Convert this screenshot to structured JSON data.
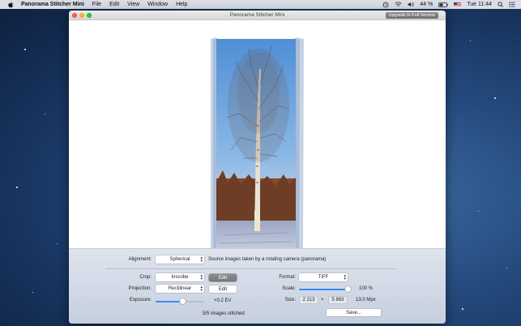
{
  "menubar": {
    "app_name": "Panorama Stitcher Mini",
    "menus": [
      "File",
      "Edit",
      "View",
      "Window",
      "Help"
    ],
    "battery": "44 %",
    "clock": "Tue 11:44",
    "icons": [
      "time-machine-icon",
      "wifi-icon",
      "volume-icon",
      "battery-icon",
      "flag-icon",
      "spotlight-icon",
      "notification-icon"
    ]
  },
  "window": {
    "title": "Panorama Stitcher Mini",
    "upgrade_label": "Upgrade to Full Version"
  },
  "controls": {
    "alignment_label": "Alignment:",
    "alignment_value": "Spherical",
    "alignment_hint": "Source images taken by a rotating camera (panorama)",
    "crop_label": "Crop:",
    "crop_value": "Inscribe",
    "crop_edit": "Edit",
    "projection_label": "Projection:",
    "projection_value": "Rectilinear",
    "projection_edit": "Edit",
    "exposure_label": "Exposure:",
    "exposure_value": "+0.2 EV",
    "exposure_fraction": 0.55,
    "format_label": "Format:",
    "format_value": "TIFF",
    "scale_label": "Scale:",
    "scale_value": "100 %",
    "scale_fraction": 1.0,
    "size_label": "Size:",
    "size_width": "2 213",
    "size_times": "×",
    "size_height": "5 863",
    "size_mpx": "13.0 Mpx",
    "status": "5/5 images stitched",
    "save_label": "Save..."
  },
  "colors": {
    "accent": "#3b87f7",
    "desktop": "#244a7d"
  }
}
